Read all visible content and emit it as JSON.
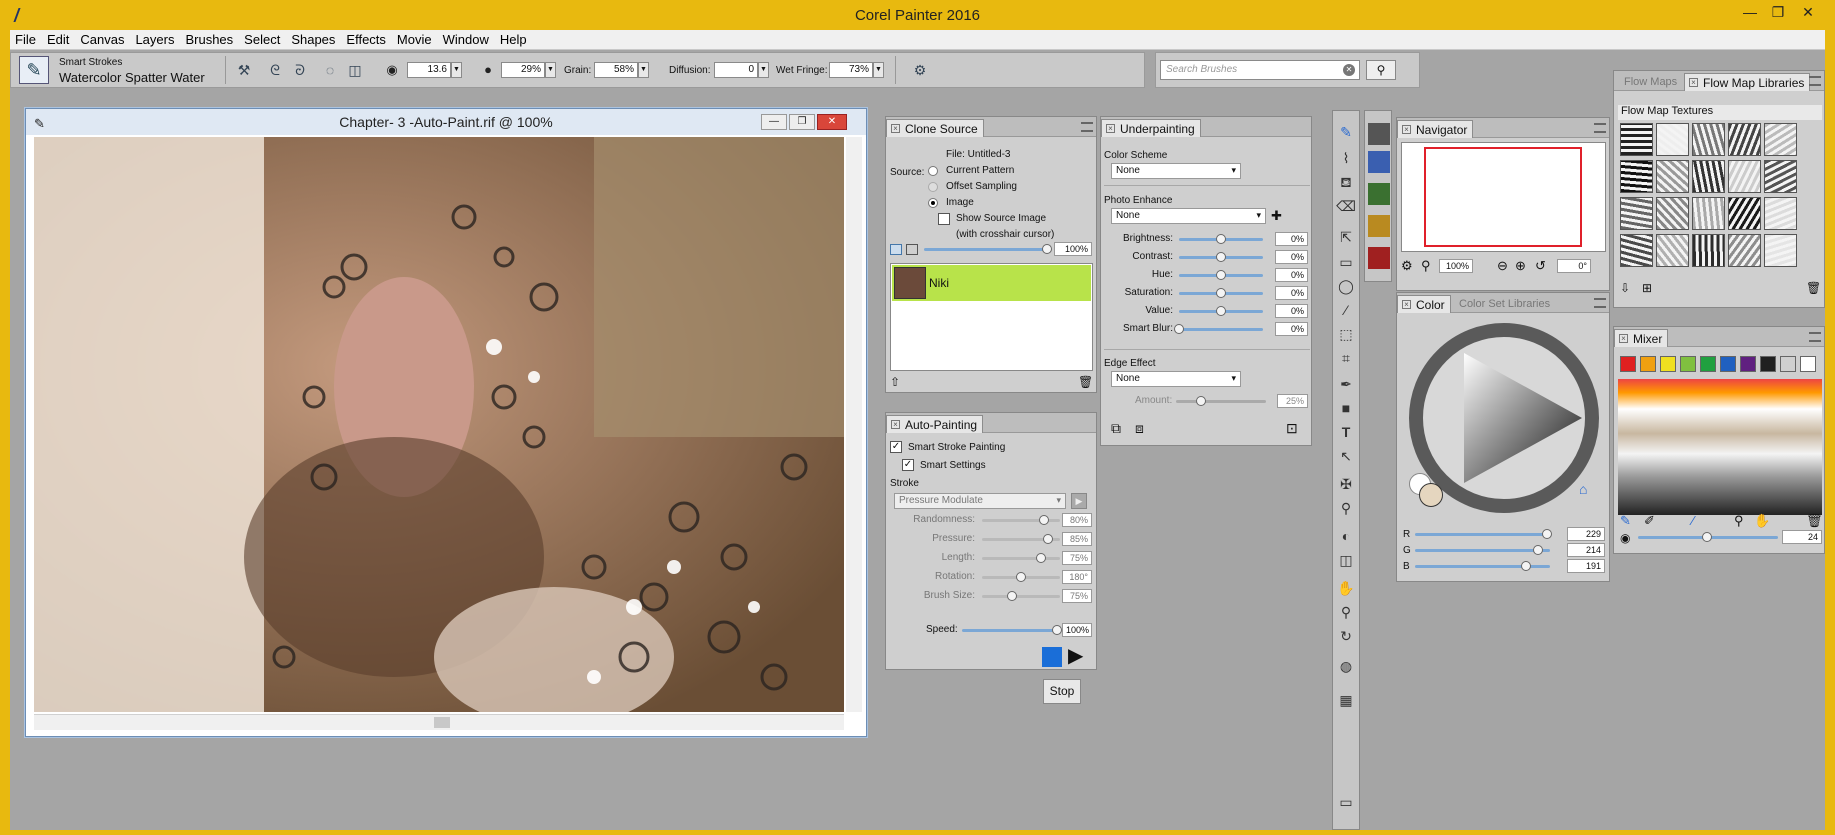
{
  "app": {
    "title": "Corel Painter 2016"
  },
  "window_controls": {
    "minimize": "—",
    "maximize": "❐",
    "close": "✕"
  },
  "menu": [
    "File",
    "Edit",
    "Canvas",
    "Layers",
    "Brushes",
    "Select",
    "Shapes",
    "Effects",
    "Movie",
    "Window",
    "Help"
  ],
  "property_bar": {
    "brush_category": "Smart Strokes",
    "brush_variant": "Watercolor Spatter Water",
    "size_value": "13.6",
    "opacity_value": "29%",
    "grain_label": "Grain:",
    "grain_value": "58%",
    "diffusion_label": "Diffusion:",
    "diffusion_value": "0",
    "wet_fringe_label": "Wet Fringe:",
    "wet_fringe_value": "73%"
  },
  "search": {
    "placeholder": "Search Brushes"
  },
  "document": {
    "title": "Chapter- 3 -Auto-Paint.rif @ 100%"
  },
  "clone_source": {
    "tab": "Clone Source",
    "file": "File: Untitled-3",
    "source_label": "Source:",
    "options": [
      "Current Pattern",
      "Offset Sampling",
      "Image"
    ],
    "selected": "Image",
    "show_source": "Show Source Image",
    "crosshair": "(with crosshair cursor)",
    "opacity": "100%",
    "item_name": "Niki"
  },
  "auto_painting": {
    "tab": "Auto-Painting",
    "smart_stroke": "Smart Stroke Painting",
    "smart_settings": "Smart Settings",
    "stroke_label": "Stroke",
    "stroke_value": "Pressure Modulate",
    "sliders": [
      {
        "label": "Randomness:",
        "value": "80%",
        "level": 0.8
      },
      {
        "label": "Pressure:",
        "value": "85%",
        "level": 0.85
      },
      {
        "label": "Length:",
        "value": "75%",
        "level": 0.75
      },
      {
        "label": "Rotation:",
        "value": "180°",
        "level": 0.5
      },
      {
        "label": "Brush Size:",
        "value": "75%",
        "level": 0.38
      }
    ],
    "speed_label": "Speed:",
    "speed_value": "100%",
    "stop_label": "Stop"
  },
  "underpainting": {
    "tab": "Underpainting",
    "color_scheme_label": "Color Scheme",
    "color_scheme_value": "None",
    "photo_enhance_label": "Photo Enhance",
    "photo_enhance_value": "None",
    "sliders": [
      {
        "label": "Brightness:",
        "value": "0%",
        "level": 0.5
      },
      {
        "label": "Contrast:",
        "value": "0%",
        "level": 0.5
      },
      {
        "label": "Hue:",
        "value": "0%",
        "level": 0.5
      },
      {
        "label": "Saturation:",
        "value": "0%",
        "level": 0.5
      },
      {
        "label": "Value:",
        "value": "0%",
        "level": 0.5
      },
      {
        "label": "Smart Blur:",
        "value": "0%",
        "level": 0.0
      }
    ],
    "edge_effect_label": "Edge Effect",
    "edge_effect_value": "None",
    "amount_label": "Amount:",
    "amount_value": "25%"
  },
  "navigator": {
    "tab": "Navigator",
    "zoom": "100%",
    "rotation": "0°"
  },
  "color": {
    "tab": "Color",
    "tab2": "Color Set Libraries",
    "r": "229",
    "g": "214",
    "b": "191",
    "r_label": "R",
    "g_label": "G",
    "b_label": "B"
  },
  "flow_maps": {
    "tab1": "Flow Maps",
    "tab2": "Flow Map Libraries",
    "section": "Flow Map Textures"
  },
  "mixer": {
    "tab": "Mixer",
    "size": "24",
    "swatches": [
      "#e02020",
      "#f0a010",
      "#f0e020",
      "#80c040",
      "#20a040",
      "#2060c0",
      "#602080",
      "#202020",
      "#d0d0d0",
      "#ffffff"
    ]
  }
}
